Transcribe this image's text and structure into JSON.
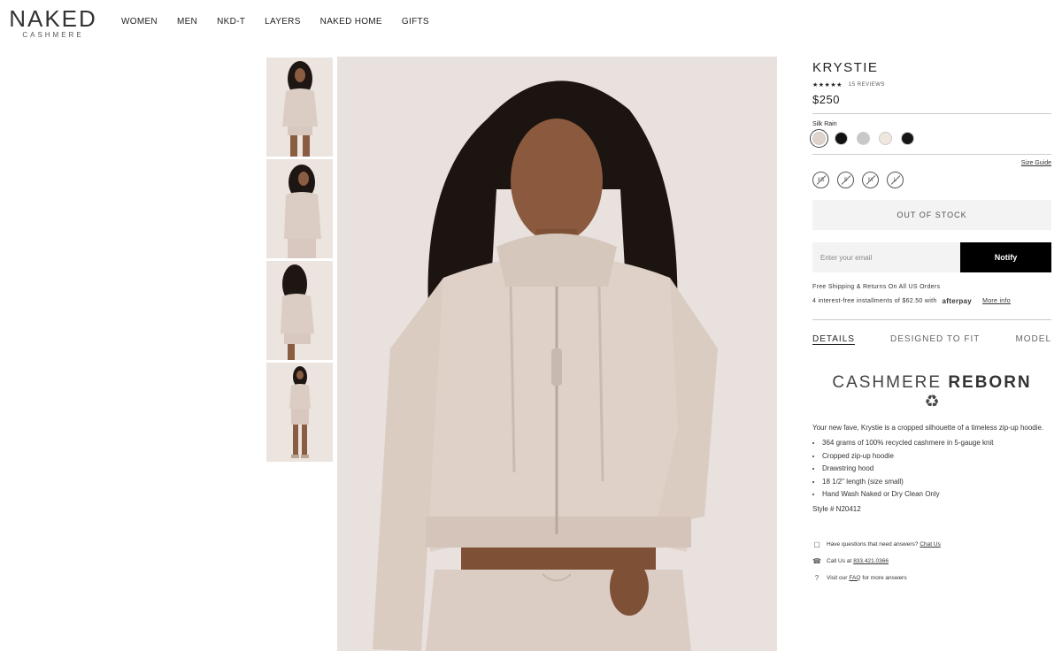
{
  "brand": {
    "name": "NAKED",
    "sub": "CASHMERE"
  },
  "nav": [
    "WOMEN",
    "MEN",
    "NKD-T",
    "LAYERS",
    "NAKED HOME",
    "GIFTS"
  ],
  "product": {
    "title": "KRYSTIE",
    "stars": "★★★★★",
    "reviews": "15 REVIEWS",
    "price": "$250",
    "color_label": "Silk Rain",
    "swatches": [
      "#dfd3cc",
      "#111111",
      "#c8c8c8",
      "#efe7de",
      "#161616"
    ],
    "size_guide": "Size Guide",
    "sizes": [
      "XS",
      "S",
      "M",
      "L"
    ],
    "out_of_stock": "OUT OF STOCK",
    "email_placeholder": "Enter your email",
    "notify": "Notify",
    "shipping": "Free Shipping & Returns On All US Orders",
    "installments": "4 interest-free installments of $62.50 with",
    "afterpay": "afterpay",
    "more_info": "More info"
  },
  "tabs": [
    "DETAILS",
    "DESIGNED TO FIT",
    "MODEL"
  ],
  "reborn": {
    "light": "CASHMERE",
    "bold": "REBORN",
    "icon": "♻"
  },
  "description": "Your new fave, Krystie is a cropped silhouette of a timeless zip-up hoodie.",
  "bullets": [
    "364 grams of 100% recycled cashmere in 5-gauge knit",
    "Cropped zip-up hoodie",
    "Drawstring hood",
    "18 1/2\" length (size small)",
    "Hand Wash Naked or Dry Clean Only"
  ],
  "style_no": "Style # N20412",
  "help": {
    "chat_pre": "Have questions that need answers?",
    "chat_link": "Chat Us",
    "call_pre": "Call Us at",
    "call_link": "833.421.0366",
    "faq_pre": "Visit our",
    "faq_link": "FAQ",
    "faq_post": "for more answers"
  }
}
